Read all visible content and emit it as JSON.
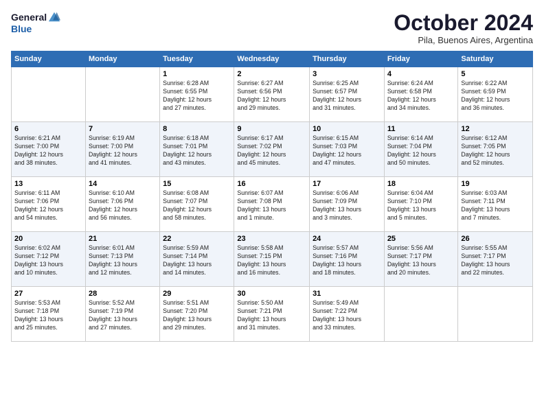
{
  "logo": {
    "general": "General",
    "blue": "Blue"
  },
  "title": "October 2024",
  "subtitle": "Pila, Buenos Aires, Argentina",
  "days_header": [
    "Sunday",
    "Monday",
    "Tuesday",
    "Wednesday",
    "Thursday",
    "Friday",
    "Saturday"
  ],
  "weeks": [
    [
      {
        "day": "",
        "info": ""
      },
      {
        "day": "",
        "info": ""
      },
      {
        "day": "1",
        "info": "Sunrise: 6:28 AM\nSunset: 6:55 PM\nDaylight: 12 hours\nand 27 minutes."
      },
      {
        "day": "2",
        "info": "Sunrise: 6:27 AM\nSunset: 6:56 PM\nDaylight: 12 hours\nand 29 minutes."
      },
      {
        "day": "3",
        "info": "Sunrise: 6:25 AM\nSunset: 6:57 PM\nDaylight: 12 hours\nand 31 minutes."
      },
      {
        "day": "4",
        "info": "Sunrise: 6:24 AM\nSunset: 6:58 PM\nDaylight: 12 hours\nand 34 minutes."
      },
      {
        "day": "5",
        "info": "Sunrise: 6:22 AM\nSunset: 6:59 PM\nDaylight: 12 hours\nand 36 minutes."
      }
    ],
    [
      {
        "day": "6",
        "info": "Sunrise: 6:21 AM\nSunset: 7:00 PM\nDaylight: 12 hours\nand 38 minutes."
      },
      {
        "day": "7",
        "info": "Sunrise: 6:19 AM\nSunset: 7:00 PM\nDaylight: 12 hours\nand 41 minutes."
      },
      {
        "day": "8",
        "info": "Sunrise: 6:18 AM\nSunset: 7:01 PM\nDaylight: 12 hours\nand 43 minutes."
      },
      {
        "day": "9",
        "info": "Sunrise: 6:17 AM\nSunset: 7:02 PM\nDaylight: 12 hours\nand 45 minutes."
      },
      {
        "day": "10",
        "info": "Sunrise: 6:15 AM\nSunset: 7:03 PM\nDaylight: 12 hours\nand 47 minutes."
      },
      {
        "day": "11",
        "info": "Sunrise: 6:14 AM\nSunset: 7:04 PM\nDaylight: 12 hours\nand 50 minutes."
      },
      {
        "day": "12",
        "info": "Sunrise: 6:12 AM\nSunset: 7:05 PM\nDaylight: 12 hours\nand 52 minutes."
      }
    ],
    [
      {
        "day": "13",
        "info": "Sunrise: 6:11 AM\nSunset: 7:06 PM\nDaylight: 12 hours\nand 54 minutes."
      },
      {
        "day": "14",
        "info": "Sunrise: 6:10 AM\nSunset: 7:06 PM\nDaylight: 12 hours\nand 56 minutes."
      },
      {
        "day": "15",
        "info": "Sunrise: 6:08 AM\nSunset: 7:07 PM\nDaylight: 12 hours\nand 58 minutes."
      },
      {
        "day": "16",
        "info": "Sunrise: 6:07 AM\nSunset: 7:08 PM\nDaylight: 13 hours\nand 1 minute."
      },
      {
        "day": "17",
        "info": "Sunrise: 6:06 AM\nSunset: 7:09 PM\nDaylight: 13 hours\nand 3 minutes."
      },
      {
        "day": "18",
        "info": "Sunrise: 6:04 AM\nSunset: 7:10 PM\nDaylight: 13 hours\nand 5 minutes."
      },
      {
        "day": "19",
        "info": "Sunrise: 6:03 AM\nSunset: 7:11 PM\nDaylight: 13 hours\nand 7 minutes."
      }
    ],
    [
      {
        "day": "20",
        "info": "Sunrise: 6:02 AM\nSunset: 7:12 PM\nDaylight: 13 hours\nand 10 minutes."
      },
      {
        "day": "21",
        "info": "Sunrise: 6:01 AM\nSunset: 7:13 PM\nDaylight: 13 hours\nand 12 minutes."
      },
      {
        "day": "22",
        "info": "Sunrise: 5:59 AM\nSunset: 7:14 PM\nDaylight: 13 hours\nand 14 minutes."
      },
      {
        "day": "23",
        "info": "Sunrise: 5:58 AM\nSunset: 7:15 PM\nDaylight: 13 hours\nand 16 minutes."
      },
      {
        "day": "24",
        "info": "Sunrise: 5:57 AM\nSunset: 7:16 PM\nDaylight: 13 hours\nand 18 minutes."
      },
      {
        "day": "25",
        "info": "Sunrise: 5:56 AM\nSunset: 7:17 PM\nDaylight: 13 hours\nand 20 minutes."
      },
      {
        "day": "26",
        "info": "Sunrise: 5:55 AM\nSunset: 7:17 PM\nDaylight: 13 hours\nand 22 minutes."
      }
    ],
    [
      {
        "day": "27",
        "info": "Sunrise: 5:53 AM\nSunset: 7:18 PM\nDaylight: 13 hours\nand 25 minutes."
      },
      {
        "day": "28",
        "info": "Sunrise: 5:52 AM\nSunset: 7:19 PM\nDaylight: 13 hours\nand 27 minutes."
      },
      {
        "day": "29",
        "info": "Sunrise: 5:51 AM\nSunset: 7:20 PM\nDaylight: 13 hours\nand 29 minutes."
      },
      {
        "day": "30",
        "info": "Sunrise: 5:50 AM\nSunset: 7:21 PM\nDaylight: 13 hours\nand 31 minutes."
      },
      {
        "day": "31",
        "info": "Sunrise: 5:49 AM\nSunset: 7:22 PM\nDaylight: 13 hours\nand 33 minutes."
      },
      {
        "day": "",
        "info": ""
      },
      {
        "day": "",
        "info": ""
      }
    ]
  ]
}
